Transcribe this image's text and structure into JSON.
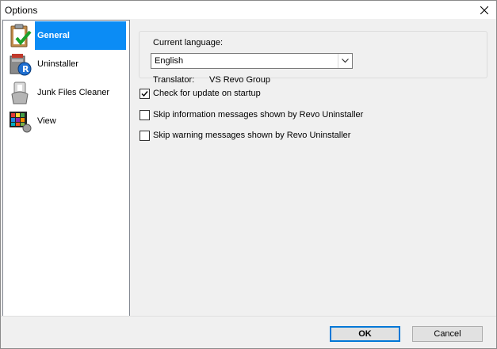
{
  "window": {
    "title": "Options"
  },
  "sidebar": {
    "items": [
      {
        "label": "General",
        "icon": "clipboard-check-icon",
        "selected": true
      },
      {
        "label": "Uninstaller",
        "icon": "uninstaller-icon",
        "selected": false
      },
      {
        "label": "Junk Files Cleaner",
        "icon": "junk-cleaner-icon",
        "selected": false
      },
      {
        "label": "View",
        "icon": "view-palette-icon",
        "selected": false
      }
    ]
  },
  "general": {
    "language_group_label": "Current language:",
    "language_value": "English",
    "translator_label": "Translator:",
    "translator_value": "VS Revo Group",
    "options": [
      {
        "label": "Check for update on startup",
        "checked": true
      },
      {
        "label": "Skip information messages shown by Revo Uninstaller",
        "checked": false
      },
      {
        "label": "Skip warning messages shown by Revo Uninstaller",
        "checked": false
      }
    ]
  },
  "footer": {
    "ok_label": "OK",
    "cancel_label": "Cancel"
  },
  "colors": {
    "selection": "#0b8cf5",
    "ok_border": "#0078d7"
  }
}
